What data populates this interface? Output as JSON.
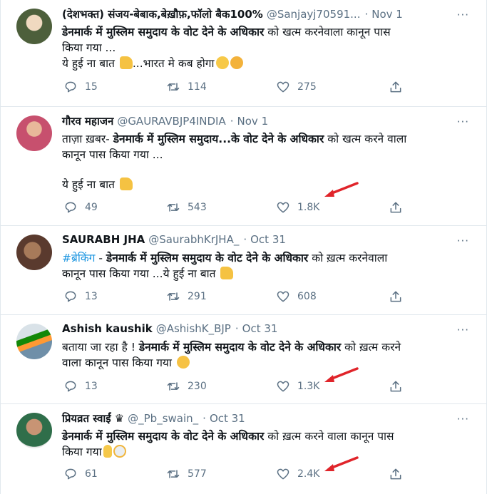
{
  "tweets": [
    {
      "name": "(देशभक्त) संजय-बेबाक,बेख़ौफ़,फॉलो बैक100%",
      "handle": "@Sanjayj70591...",
      "dot": "·",
      "date": "Nov 1",
      "more": "···",
      "l1_bold": "डेनमार्क में मुस्लिम समुदाय के वोट देने के अधिकार",
      "l1_rest": " को खत्म करनेवाला कानून पास",
      "l2": "किया गया ...",
      "l3": "ये हुई ना बात ",
      "l3b": "...भारत मे कब होगा",
      "emoji1": "thumbs-up",
      "emoji2": "confused-face",
      "emoji3": "thinking-face",
      "replies": "15",
      "retweets": "114",
      "likes": "275",
      "avatar_color": "#4d5f3b"
    },
    {
      "name": "गौरव महाजन",
      "handle": "@GAURAVBJP4INDIA",
      "dot": "·",
      "date": "Nov 1",
      "more": "···",
      "l1_pre": "ताज़ा ख़बर- ",
      "l1_bold": "डेनमार्क में मुस्लिम समुदाय...के वोट देने के अधिकार",
      "l1_rest": " को खत्म करने वाला",
      "l2": "कानून पास किया गया ...",
      "l3": "ये हुई ना बात ",
      "emoji1": "thumbs-up",
      "replies": "49",
      "retweets": "543",
      "likes": "1.8K",
      "avatar_color": "#c7506e"
    },
    {
      "name": "SAURABH JHA",
      "handle": "@SaurabhKrJHA_",
      "dot": "·",
      "date": "Oct 31",
      "more": "···",
      "l1_tag": "#ब्रेकिंग",
      "l1_pre": " - ",
      "l1_bold": "डेनमार्क में मुस्लिम समुदाय के वोट देने के अधिकार",
      "l1_rest": " को ख़त्म करनेवाला",
      "l2": "कानून पास किया गया ...ये हुई ना बात ",
      "emoji1": "thumbs-up",
      "replies": "13",
      "retweets": "291",
      "likes": "608",
      "avatar_color": "#5a3a2e"
    },
    {
      "name": "Ashish kaushik",
      "handle": "@AshishK_BJP",
      "dot": "·",
      "date": "Oct 31",
      "more": "···",
      "l1_pre": "बताया जा रहा है ! ",
      "l1_bold": "डेनमार्क में मुस्लिम समुदाय के वोट देने के अधिकार",
      "l1_rest": " को ख़त्म करने",
      "l2": "वाला कानून पास किया गया ",
      "emoji1": "hugging-face",
      "replies": "13",
      "retweets": "230",
      "likes": "1.3K",
      "avatar_color": "#6f8fa8"
    },
    {
      "name": "प्रियव्रत स्वाईं",
      "crown": "♛",
      "handle": "@_Pb_swain_",
      "dot": "·",
      "date": "Oct 31",
      "more": "···",
      "l1_bold": "डेनमार्क में मुस्लिम समुदाय के वोट देने के अधिकार",
      "l1_rest": " को ख़त्म करने वाला कानून पास",
      "l2": "किया गया",
      "emoji1": "victory-hand",
      "emoji2": "screaming-face",
      "replies": "61",
      "retweets": "577",
      "likes": "2.4K",
      "avatar_color": "#2f6e4a"
    }
  ],
  "colors": {
    "accent": "#1b95e0",
    "muted": "#5b7083",
    "arrow": "#e0242a"
  }
}
